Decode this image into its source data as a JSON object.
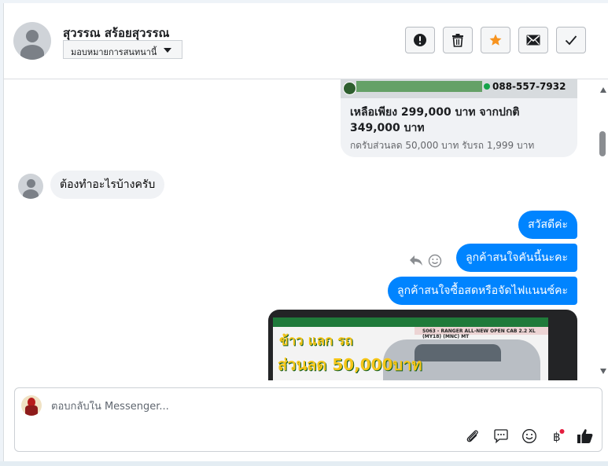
{
  "header": {
    "contact_name": "สุวรรณ สร้อยสุวรรณ",
    "assign_label": "มอบหมายการสนทนานี้",
    "actions": [
      "spam-icon",
      "trash-icon",
      "star-icon",
      "envelope-icon",
      "checkmark-icon"
    ],
    "star_color": "#f7931e"
  },
  "conversation": {
    "product_card": {
      "phone": "088-557-7932",
      "title": "เหลือเพียง 299,000 บาท จากปกติ 349,000 บาท",
      "subtitle": "กดรับส่วนลด 50,000 บาท รับรถ 1,999 บาท"
    },
    "incoming_message": "ต้องทำอะไรบ้างครับ",
    "outgoing_messages": [
      "สวัสดีค่ะ",
      "ลูกค้าสนใจคันนี้นะคะ",
      "ลูกค้าสนใจซื้อสดหรือจัดไฟแนนซ์คะ"
    ],
    "image_ad": {
      "code": "S063 - RANGER ALL-NEW OPEN CAB 2.2 XL (MY18) (MNC) MT",
      "headline": "ข้าว แลก รถ",
      "discount": "ส่วนลด 50,000บาท"
    },
    "outgoing_color": "#0084ff"
  },
  "composer": {
    "placeholder": "ตอบกลับใน Messenger...",
    "tools": [
      "paperclip-icon",
      "saved-replies-icon",
      "emoji-icon",
      "baht-icon",
      "thumbs-up-icon"
    ]
  }
}
